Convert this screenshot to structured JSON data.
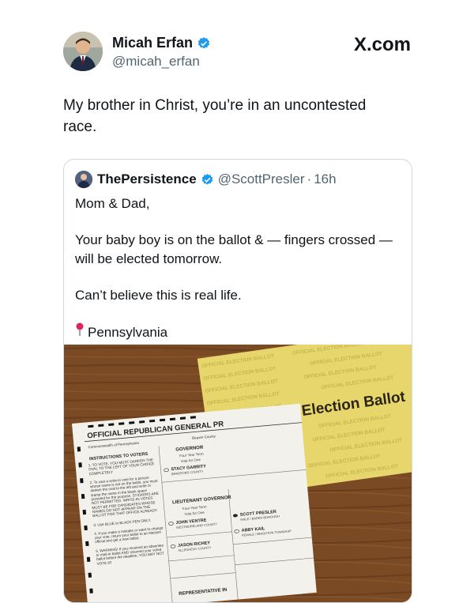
{
  "author": {
    "name": "Micah Erfan",
    "handle": "@micah_erfan"
  },
  "brand": "X.com",
  "tweet_text": "My brother in Christ, you’re in an uncontested race.",
  "quote": {
    "name": "ThePersistence",
    "handle": "@ScottPresler",
    "dot": "·",
    "time": "16h",
    "lines": [
      "Mom & Dad,",
      "Your baby boy is on the ballot & — fingers crossed — will be elected tomorrow.",
      "Can’t believe this is real life.",
      "Pennsylvania"
    ]
  },
  "photo": {
    "envelope_title": "Official Election Ballot",
    "envelope_pattern": "OFFICIAL ELECTION BALLOT",
    "ballot_title": "OFFICIAL REPUBLICAN GENERAL PR",
    "commonwealth": "Commonwealth of Pennsylvania",
    "county": "Beaver County",
    "instructions_title": "INSTRUCTIONS TO VOTERS",
    "instructions": [
      "1. TO VOTE, YOU MUST DARKEN THE OVAL TO THE LEFT OF YOUR CHOICE COMPLETELY",
      "2. To cast a write-in vote for a person whose name is not on the ballot, you must darken the oval to the left and write or stamp the name in the blank space provided for the purpose. STICKERS ARE NOT PERMITTED. WRITE-IN VOTES MUST BE FOR CANDIDATES WHOSE NAMES DO NOT APPEAR ON THE BALLOT FOR THAT OFFICE ALREADY.",
      "3. Use BLUE or BLACK PEN ONLY.",
      "4. If you make a mistake or want to change your vote, return your ballot to an election official and get a new ballot.",
      "5. WARNING! If you received an absentee or mail-in ballot AND returned your voted ballot before the deadline, YOU MAY NOT VOTE AT"
    ],
    "offices": [
      {
        "title": "GOVERNOR",
        "term": "Four Year Term",
        "vote_for": "Vote for One",
        "candidate": "STACY GARRITY",
        "county": "BRADFORD COUNTY"
      },
      {
        "title": "LIEUTENANT GOVERNOR",
        "term": "Four Year Term",
        "vote_for": "Vote for One",
        "candidate": "JOHN VENTRE",
        "county": "WESTMORELAND COUNTY"
      },
      {
        "title": "",
        "term": "",
        "vote_for": "",
        "candidate": "JASON RICHEY",
        "county": "ALLEGHENY COUNTY"
      }
    ],
    "right_candidates": [
      {
        "name": "SCOTT PRESLER",
        "detail": "MALE / BADEN BOROUGH"
      },
      {
        "name": "ABBY KAIL",
        "detail": "FEMALE / BRIGHTON TOWNSHIP"
      }
    ],
    "bottom_heading": "REPRESENTATIVE IN"
  },
  "colors": {
    "verified": "#1d9bf0",
    "text": "#0f1419",
    "secondary": "#536471",
    "envelope": "#e7d66b",
    "wood": "#7a4a25"
  }
}
